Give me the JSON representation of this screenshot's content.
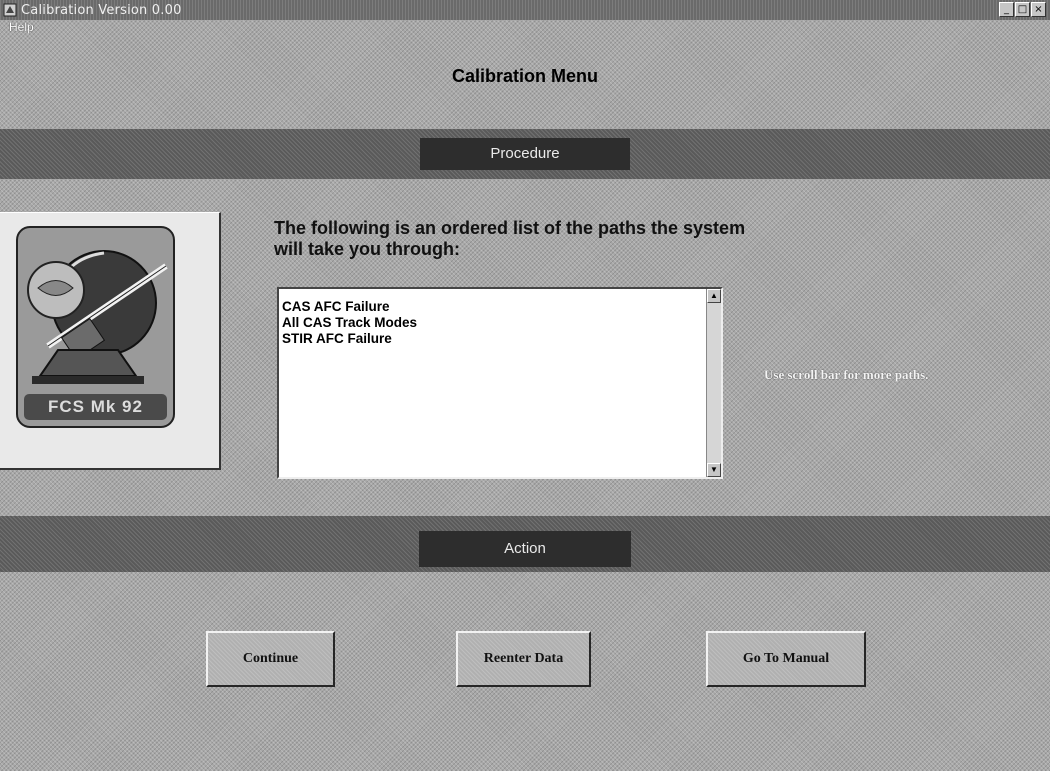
{
  "window": {
    "title": "Calibration Version 0.00",
    "controls": {
      "minimize": "_",
      "maximize": "□",
      "close": "×"
    }
  },
  "menu": {
    "help": "Help"
  },
  "screen_title": "Calibration Menu",
  "procedure": {
    "header": "Procedure",
    "intro": "The following is an ordered list of the paths the system will take you through:",
    "paths": [
      "CAS AFC Failure",
      "All CAS Track Modes",
      "STIR AFC Failure"
    ],
    "hint": "Use scroll bar for more paths."
  },
  "logo": {
    "text": "FCS Mk 92"
  },
  "action": {
    "header": "Action",
    "buttons": {
      "continue": "Continue",
      "reenter": "Reenter Data",
      "manual": "Go To Manual"
    }
  },
  "icons": {
    "app": "app-icon",
    "scroll_up": "scroll-up-arrow-icon",
    "scroll_down": "scroll-down-arrow-icon",
    "logo": "fcs-emblem-icon"
  }
}
